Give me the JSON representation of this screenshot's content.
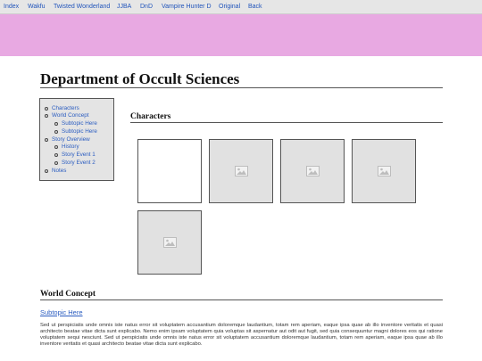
{
  "topnav": {
    "links": [
      "Index",
      "Wakfu",
      "Twisted Wonderland",
      "JJBA",
      "DnD",
      "Vampire Hunter D",
      "Original",
      "Back"
    ]
  },
  "page": {
    "title": "Department of Occult Sciences"
  },
  "toc": {
    "items": [
      {
        "label": "Characters",
        "level": 1
      },
      {
        "label": "World Concept",
        "level": 1
      },
      {
        "label": "Subtopic Here",
        "level": 2
      },
      {
        "label": "Subtopic Here",
        "level": 2
      },
      {
        "label": "Story Overview",
        "level": 1
      },
      {
        "label": "History",
        "level": 2
      },
      {
        "label": "Story Event 1",
        "level": 2
      },
      {
        "label": "Story Event 2",
        "level": 2
      },
      {
        "label": "Notes",
        "level": 1
      }
    ]
  },
  "characters": {
    "heading": "Characters",
    "thumbnails": [
      {
        "state": "blank"
      },
      {
        "state": "image-placeholder",
        "icon": "image-icon"
      },
      {
        "state": "image-placeholder",
        "icon": "image-icon"
      },
      {
        "state": "image-placeholder",
        "icon": "image-icon"
      },
      {
        "state": "image-placeholder",
        "icon": "image-icon"
      }
    ]
  },
  "world_concept": {
    "heading": "World Concept",
    "subtopic_link": "Subtopic Here",
    "paragraph": "Sed ut perspiciatis unde omnis iste natus error sit voluptatem accusantium doloremque laudantium, totam rem aperiam, eaque ipsa quae ab illo inventore veritatis et quasi architecto beatae vitae dicta sunt explicabo. Nemo enim ipsam voluptatem quia voluptas sit aspernatur aut odit aut fugit, sed quia consequuntur magni dolores eos qui ratione voluptatem sequi nesciunt. Sed ut perspiciatis unde omnis iste natus error sit voluptatem accusantium doloremque laudantium, totam rem aperiam, eaque ipsa quae ab illo inventore veritatis et quasi architecto beatae vitae dicta sunt explicabo."
  },
  "colors": {
    "banner": "#e8a9e2",
    "link": "#2a5cc0",
    "nav_bg": "#e6e6e6"
  }
}
